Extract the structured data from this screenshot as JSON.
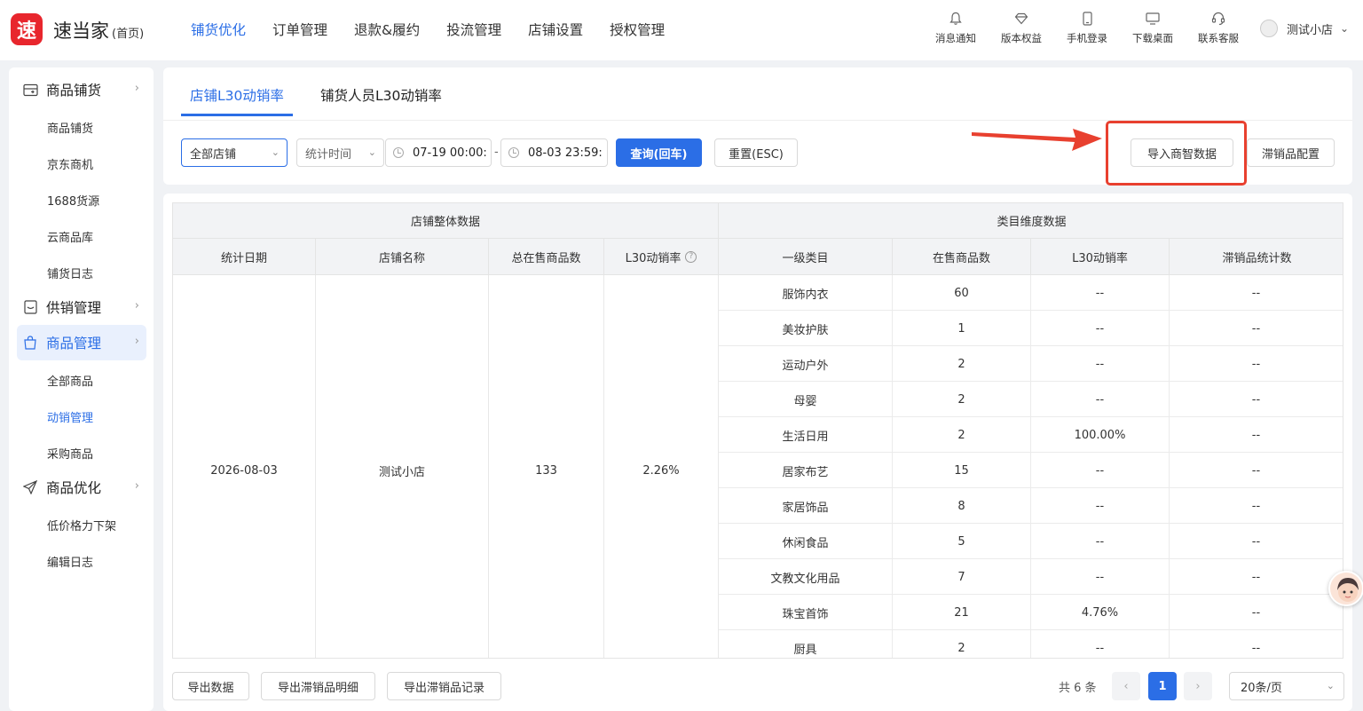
{
  "header": {
    "logo_char": "速",
    "brand": "速当家",
    "brand_sub": "(首页)",
    "nav": [
      "铺货优化",
      "订单管理",
      "退款&履约",
      "投流管理",
      "店铺设置",
      "授权管理"
    ],
    "active_nav": 0,
    "tools": [
      {
        "label": "消息通知",
        "icon": "bell-icon"
      },
      {
        "label": "版本权益",
        "icon": "diamond-icon"
      },
      {
        "label": "手机登录",
        "icon": "phone-icon"
      },
      {
        "label": "下载桌面",
        "icon": "monitor-icon"
      },
      {
        "label": "联系客服",
        "icon": "headset-icon"
      }
    ],
    "user": "测试小店"
  },
  "sidebar": {
    "groups": [
      {
        "label": "商品铺货",
        "icon": "box-icon",
        "items": [
          "商品铺货",
          "京东商机",
          "1688货源",
          "云商品库",
          "铺货日志"
        ]
      },
      {
        "label": "供销管理",
        "icon": "supply-icon",
        "items": []
      },
      {
        "label": "商品管理",
        "icon": "bag-icon",
        "items": [
          "全部商品",
          "动销管理",
          "采购商品"
        ]
      },
      {
        "label": "商品优化",
        "icon": "send-icon",
        "items": [
          "低价格力下架",
          "编辑日志"
        ]
      }
    ],
    "active_group": "商品管理",
    "active_item": "动销管理"
  },
  "tabs": [
    "店铺L30动销率",
    "铺货人员L30动销率"
  ],
  "filters": {
    "shop": "全部店铺",
    "time_type": "统计时间",
    "start": "07-19 00:00:",
    "end": "08-03 23:59:",
    "range_sep": "-",
    "query_btn": "查询(回车)",
    "reset_btn": "重置(ESC)",
    "import_btn": "导入商智数据",
    "config_btn": "滞销品配置"
  },
  "table": {
    "group_headers": [
      "店铺整体数据",
      "类目维度数据"
    ],
    "columns": [
      "统计日期",
      "店铺名称",
      "总在售商品数",
      "L30动销率",
      "一级类目",
      "在售商品数",
      "L30动销率",
      "滞销品统计数"
    ],
    "help_mark": "?",
    "shop_row": {
      "date": "2026-08-03",
      "shop": "测试小店",
      "total": "133",
      "rate": "2.26%"
    },
    "category_rows": [
      [
        "服饰内衣",
        "60",
        "--",
        "--"
      ],
      [
        "美妆护肤",
        "1",
        "--",
        "--"
      ],
      [
        "运动户外",
        "2",
        "--",
        "--"
      ],
      [
        "母婴",
        "2",
        "--",
        "--"
      ],
      [
        "生活日用",
        "2",
        "100.00%",
        "--"
      ],
      [
        "居家布艺",
        "15",
        "--",
        "--"
      ],
      [
        "家居饰品",
        "8",
        "--",
        "--"
      ],
      [
        "休闲食品",
        "5",
        "--",
        "--"
      ],
      [
        "文教文化用品",
        "7",
        "--",
        "--"
      ],
      [
        "珠宝首饰",
        "21",
        "4.76%",
        "--"
      ],
      [
        "厨具",
        "2",
        "--",
        "--"
      ]
    ]
  },
  "footer": {
    "buttons": [
      "导出数据",
      "导出滞销品明细",
      "导出滞销品记录"
    ],
    "total": "共 6 条",
    "page": "1",
    "page_size": "20条/页",
    "prev": "‹",
    "next": "›"
  }
}
